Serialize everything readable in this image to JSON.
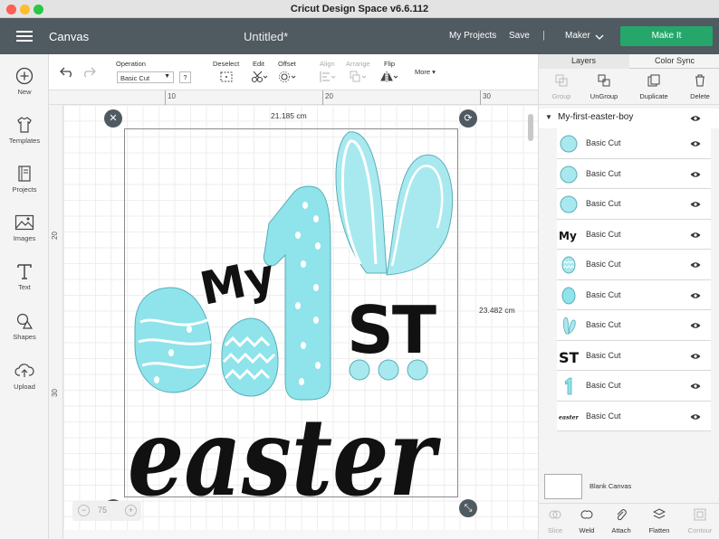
{
  "app": {
    "title": "Cricut Design Space  v6.6.112"
  },
  "header": {
    "section": "Canvas",
    "document_title": "Untitled*",
    "my_projects": "My Projects",
    "save": "Save",
    "separator": "|",
    "machine": "Maker",
    "make_it": "Make It"
  },
  "sidebar": {
    "items": [
      {
        "label": "New",
        "icon": "plus-circle-icon"
      },
      {
        "label": "Templates",
        "icon": "tshirt-icon"
      },
      {
        "label": "Projects",
        "icon": "book-icon"
      },
      {
        "label": "Images",
        "icon": "image-icon"
      },
      {
        "label": "Text",
        "icon": "text-t-icon"
      },
      {
        "label": "Shapes",
        "icon": "shapes-icon"
      },
      {
        "label": "Upload",
        "icon": "cloud-upload-icon"
      }
    ]
  },
  "toolbar": {
    "operation_label": "Operation",
    "operation_value": "Basic Cut",
    "help": "?",
    "deselect": "Deselect",
    "edit": "Edit",
    "offset": "Offset",
    "align": "Align",
    "arrange": "Arrange",
    "flip": "Flip",
    "more": "More"
  },
  "rulers": {
    "top": [
      "10",
      "20",
      "30"
    ],
    "left": [
      "20",
      "30"
    ]
  },
  "canvas": {
    "width_label": "21.185 cm",
    "height_label": "23.482 cm",
    "zoom_value": "75"
  },
  "design": {
    "line1": "My",
    "numeral": "1",
    "suffix": "ST",
    "word": "easter",
    "colors": {
      "teal": "#8fe3ea",
      "teal_stroke": "#5aaeb8",
      "black": "#111111"
    }
  },
  "panel": {
    "tabs": [
      "Layers",
      "Color Sync"
    ],
    "actions": [
      {
        "label": "Group",
        "enabled": false
      },
      {
        "label": "UnGroup",
        "enabled": true
      },
      {
        "label": "Duplicate",
        "enabled": true
      },
      {
        "label": "Delete",
        "enabled": true
      }
    ],
    "group_name": "My-first-easter-boy",
    "layers": [
      {
        "name": "Basic Cut",
        "thumb": "teal-circle"
      },
      {
        "name": "Basic Cut",
        "thumb": "teal-circle"
      },
      {
        "name": "Basic Cut",
        "thumb": "teal-circle"
      },
      {
        "name": "Basic Cut",
        "thumb": "my-text"
      },
      {
        "name": "Basic Cut",
        "thumb": "pattern-egg"
      },
      {
        "name": "Basic Cut",
        "thumb": "teal-egg"
      },
      {
        "name": "Basic Cut",
        "thumb": "bunny-ears"
      },
      {
        "name": "Basic Cut",
        "thumb": "st-text"
      },
      {
        "name": "Basic Cut",
        "thumb": "one-numeral"
      },
      {
        "name": "Basic Cut",
        "thumb": "easter-text"
      }
    ],
    "layer_thumb_text": {
      "my": "My",
      "st": "ST",
      "easter": "easter"
    },
    "blank_canvas": "Blank Canvas",
    "bottom_actions": [
      {
        "label": "Slice",
        "enabled": false
      },
      {
        "label": "Weld",
        "enabled": true
      },
      {
        "label": "Attach",
        "enabled": true
      },
      {
        "label": "Flatten",
        "enabled": true
      },
      {
        "label": "Contour",
        "enabled": false
      }
    ]
  }
}
